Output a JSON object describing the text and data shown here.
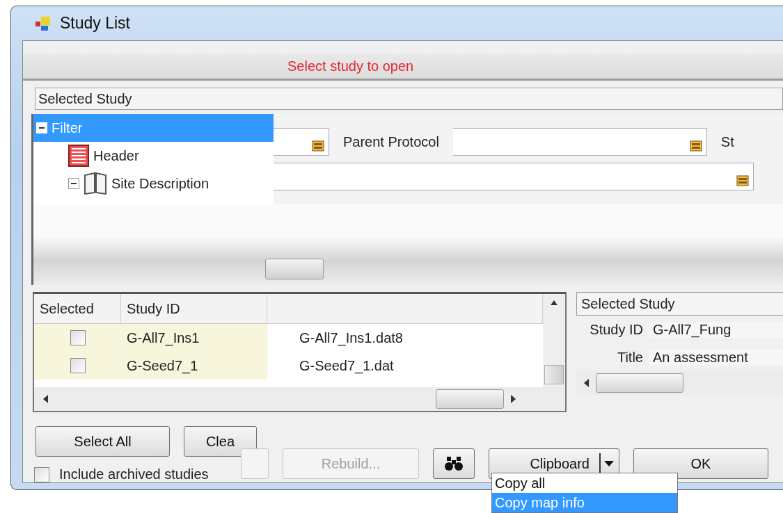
{
  "window": {
    "title": "Study List"
  },
  "message": "Select study to open",
  "filter_panel": {
    "header": "Selected Study",
    "tree": [
      {
        "label": "Filter",
        "selected": true,
        "expanded": true,
        "children": [
          {
            "label": "Header",
            "kind": "form",
            "selected": false
          },
          {
            "label": "Site Description",
            "kind": "book",
            "selected": false,
            "expanded": true
          }
        ]
      }
    ],
    "field_rows": [
      [
        {
          "kind": "field"
        },
        {
          "kind": "label",
          "text": "Parent Protocol"
        },
        {
          "kind": "field"
        },
        {
          "kind": "label",
          "text": "St"
        }
      ],
      [
        {
          "kind": "wide_field"
        }
      ]
    ]
  },
  "study_table": {
    "columns": [
      {
        "label": "Selected"
      },
      {
        "label": "Study ID"
      }
    ],
    "rows": [
      {
        "checked": false,
        "study_id": "G-All7_Ins1",
        "column_3": "G-All7_Ins1.dat8"
      },
      {
        "checked": false,
        "study_id": "G-Seed7_1",
        "column_3": "G-Seed7_1.dat"
      }
    ]
  },
  "details": {
    "header": "Selected Study",
    "fields": [
      {
        "label": "Study ID",
        "value": "G-All7_Fung"
      },
      {
        "label": "Title",
        "value": "An assessment"
      }
    ]
  },
  "buttons_row_1": [
    {
      "label": "Select All",
      "kind": "button"
    },
    {
      "label": "Clea",
      "kind": "button"
    }
  ],
  "buttons_row_2": [
    {
      "kind": "blank",
      "disabled": true
    },
    {
      "label": "Rebuild...",
      "kind": "button",
      "disabled": true
    },
    {
      "kind": "binoculars",
      "disabled": false
    },
    {
      "label": "Clipboard",
      "kind": "split",
      "disabled": false
    },
    {
      "label": "OK",
      "kind": "button",
      "disabled": false
    }
  ],
  "include_archived": {
    "label": "Include archived studies",
    "checked": false
  },
  "clipboard_menu": [
    {
      "label": "Copy all",
      "selected": false
    },
    {
      "label": "Copy map info",
      "selected": true
    }
  ]
}
